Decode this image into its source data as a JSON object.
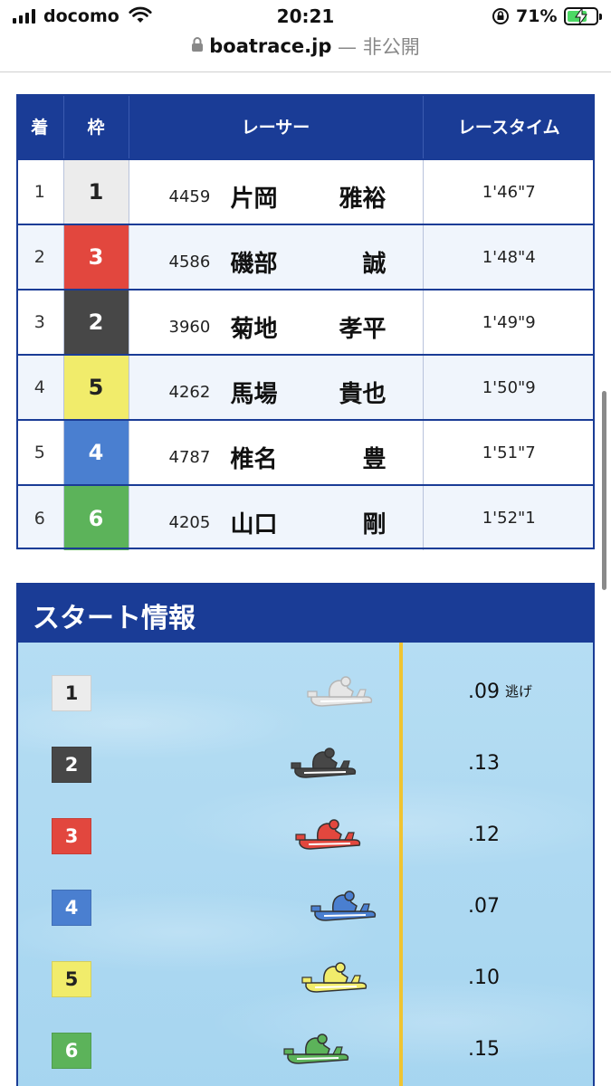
{
  "status_bar": {
    "carrier": "docomo",
    "time": "20:21",
    "battery_percent": "71%",
    "battery_level": 0.71,
    "charging": true
  },
  "url_bar": {
    "domain": "boatrace.jp",
    "visibility": " — 非公開"
  },
  "frame_colors": {
    "1": {
      "bg": "#ececec",
      "fg": "#222222"
    },
    "2": {
      "bg": "#474747",
      "fg": "#ffffff"
    },
    "3": {
      "bg": "#e2473e",
      "fg": "#ffffff"
    },
    "4": {
      "bg": "#4a7fd0",
      "fg": "#ffffff"
    },
    "5": {
      "bg": "#f1ec6b",
      "fg": "#222222"
    },
    "6": {
      "bg": "#5cb35a",
      "fg": "#ffffff"
    }
  },
  "results": {
    "headers": {
      "rank": "着",
      "frame": "枠",
      "racer": "レーサー",
      "time": "レースタイム"
    },
    "rows": [
      {
        "rank": "1",
        "frame": "1",
        "reg_no": "4459",
        "surname": "片岡",
        "given": "雅裕",
        "time": "1'46\"7"
      },
      {
        "rank": "2",
        "frame": "3",
        "reg_no": "4586",
        "surname": "磯部",
        "given": "誠",
        "time": "1'48\"4"
      },
      {
        "rank": "3",
        "frame": "2",
        "reg_no": "3960",
        "surname": "菊地",
        "given": "孝平",
        "time": "1'49\"9"
      },
      {
        "rank": "4",
        "frame": "5",
        "reg_no": "4262",
        "surname": "馬場",
        "given": "貴也",
        "time": "1'50\"9"
      },
      {
        "rank": "5",
        "frame": "4",
        "reg_no": "4787",
        "surname": "椎名",
        "given": "豊",
        "time": "1'51\"7"
      },
      {
        "rank": "6",
        "frame": "6",
        "reg_no": "4205",
        "surname": "山口",
        "given": "剛",
        "time": "1'52\"1"
      }
    ]
  },
  "start_info": {
    "title": "スタート情報",
    "lanes": [
      {
        "lane": "1",
        "st": ".09",
        "note": "逃げ",
        "boat_color": "#e6e6e6"
      },
      {
        "lane": "2",
        "st": ".13",
        "note": "",
        "boat_color": "#474747"
      },
      {
        "lane": "3",
        "st": ".12",
        "note": "",
        "boat_color": "#e2473e"
      },
      {
        "lane": "4",
        "st": ".07",
        "note": "",
        "boat_color": "#4a7fd0"
      },
      {
        "lane": "5",
        "st": ".10",
        "note": "",
        "boat_color": "#f1ec6b"
      },
      {
        "lane": "6",
        "st": ".15",
        "note": "",
        "boat_color": "#5cb35a"
      }
    ]
  }
}
